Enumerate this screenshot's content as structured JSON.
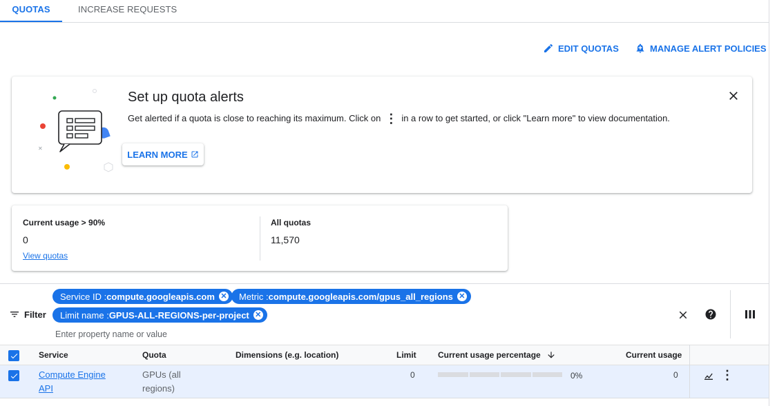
{
  "tabs": [
    {
      "label": "QUOTAS",
      "active": true
    },
    {
      "label": "INCREASE REQUESTS",
      "active": false
    }
  ],
  "actions": {
    "edit_quotas": "EDIT QUOTAS",
    "manage_alert_policies": "MANAGE ALERT POLICIES"
  },
  "alert": {
    "title": "Set up quota alerts",
    "text_before": "Get alerted if a quota is close to reaching its maximum. Click on",
    "text_after": "in a row to get started, or click \"Learn more\" to view documentation.",
    "learn_more": "LEARN MORE"
  },
  "summary": {
    "usage_label": "Current usage > 90%",
    "usage_value": "0",
    "view_quotas": "View quotas",
    "all_label": "All quotas",
    "all_value": "11,570"
  },
  "filter": {
    "label": "Filter",
    "placeholder": "Enter property name or value",
    "chips": [
      {
        "key": "Service ID : ",
        "value": "compute.googleapis.com"
      },
      {
        "key": "Metric : ",
        "value": "compute.googleapis.com/gpus_all_regions"
      },
      {
        "key": "Limit name : ",
        "value": "GPUS-ALL-REGIONS-per-project"
      }
    ]
  },
  "table": {
    "headers": {
      "service": "Service",
      "quota": "Quota",
      "dimensions": "Dimensions (e.g. location)",
      "limit": "Limit",
      "usage_pct": "Current usage percentage",
      "usage": "Current usage"
    },
    "rows": [
      {
        "service_line1": "Compute Engine",
        "service_line2": "API",
        "quota_line1": "GPUs (all",
        "quota_line2": "regions)",
        "dimensions": "",
        "limit": "0",
        "usage_pct": "0%",
        "usage_fraction": 0,
        "usage": "0"
      }
    ]
  },
  "colors": {
    "accent": "#1a73e8",
    "row_selected": "#e8f0fe"
  }
}
